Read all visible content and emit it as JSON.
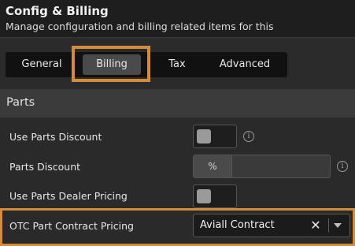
{
  "header": {
    "title": "Config & Billing",
    "subtitle": "Manage configuration and billing related items for this"
  },
  "tabs": [
    {
      "label": "General",
      "active": false
    },
    {
      "label": "Billing",
      "active": true
    },
    {
      "label": "Tax",
      "active": false
    },
    {
      "label": "Advanced",
      "active": false
    }
  ],
  "section": {
    "title": "Parts"
  },
  "fields": {
    "use_parts_discount": {
      "label": "Use Parts Discount",
      "value": false
    },
    "parts_discount": {
      "label": "Parts Discount",
      "addon": "%",
      "value": ""
    },
    "use_parts_dealer_pricing": {
      "label": "Use Parts Dealer Pricing",
      "value": false
    },
    "otc_part_contract_pricing": {
      "label": "OTC Part Contract Pricing",
      "value": "Aviall Contract"
    }
  },
  "icons": {
    "info": "info-icon",
    "info_glyph": "i",
    "clear": "close-icon",
    "clear_glyph": "✕",
    "dropdown": "chevron-down-icon"
  },
  "colors": {
    "highlight": "#d48b3b",
    "background": "#2a2a2a",
    "header_bg": "#1e1e1e",
    "section_bg": "#3b3b3b"
  }
}
